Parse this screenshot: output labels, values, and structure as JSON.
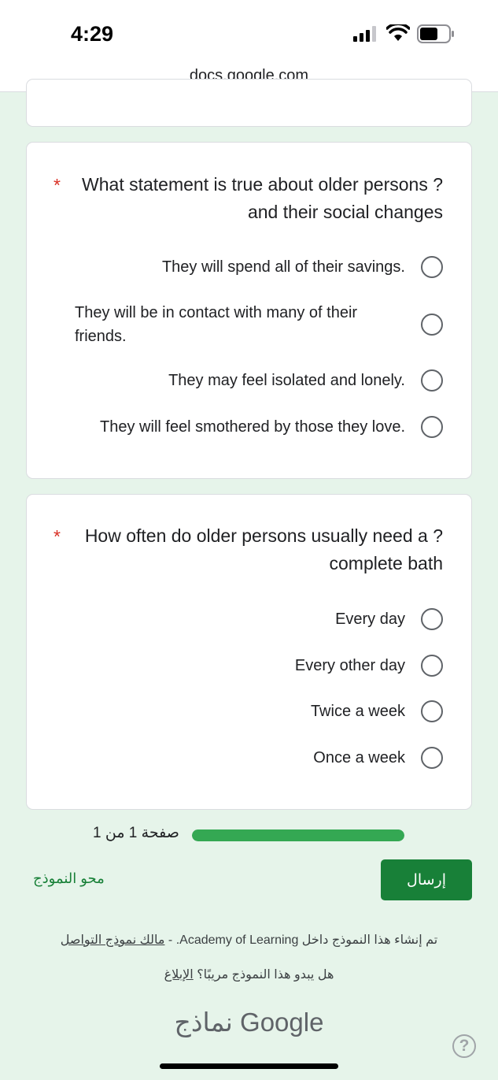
{
  "status_bar": {
    "time": "4:29"
  },
  "browser": {
    "url": "docs.google.com"
  },
  "questions": [
    {
      "required_mark": "*",
      "title": "What statement is true about older persons ?and their social changes",
      "options": [
        "They will spend all of their savings.",
        "They will be in contact with many of their friends.",
        "They may feel isolated and lonely.",
        "They will feel smothered by those they love."
      ]
    },
    {
      "required_mark": "*",
      "title": "How often do older persons usually need a ?complete bath",
      "options": [
        "Every day",
        "Every other day",
        "Twice a week",
        "Once a week"
      ]
    }
  ],
  "progress": {
    "label": "صفحة 1 من 1",
    "percent": 100,
    "color": "#34a853"
  },
  "actions": {
    "submit": "إرسال",
    "clear": "محو النموذج"
  },
  "footer": {
    "created_text": "تم إنشاء هذا النموذج داخل Academy of Learning.",
    "contact_link": "مالك نموذج التواصل",
    "separator": " - ",
    "report_text": "هل يبدو هذا النموذج مريبًا؟",
    "report_link": "الإبلاغ",
    "brand": "Google نماذج"
  },
  "colors": {
    "background": "#e6f4ea",
    "accent": "#188038",
    "required": "#d93025"
  },
  "icons": [
    "signal-icon",
    "wifi-icon",
    "battery-icon",
    "help-icon"
  ]
}
